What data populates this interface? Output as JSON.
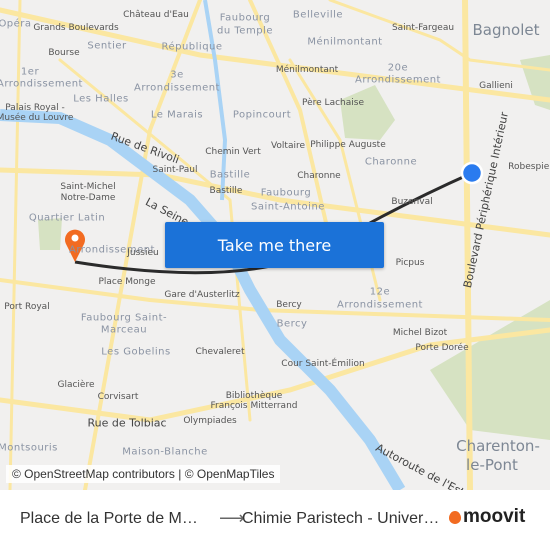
{
  "map": {
    "labels": [
      {
        "text": "Château d'Eau",
        "cls": ""
      },
      {
        "text": "Faubourg",
        "cls": "area"
      },
      {
        "text": "du Temple",
        "cls": "area"
      },
      {
        "text": "Belleville",
        "cls": "area"
      },
      {
        "text": "Saint-Fargeau",
        "cls": ""
      },
      {
        "text": "Bagnolet",
        "cls": "big"
      },
      {
        "text": "Opéra",
        "cls": "area"
      },
      {
        "text": "Grands Boulevards",
        "cls": ""
      },
      {
        "text": "Sentier",
        "cls": "area"
      },
      {
        "text": "République",
        "cls": "area"
      },
      {
        "text": "Ménilmontant",
        "cls": "area"
      },
      {
        "text": "Bourse",
        "cls": ""
      },
      {
        "text": "1er",
        "cls": "area"
      },
      {
        "text": "Arrondissement",
        "cls": "area"
      },
      {
        "text": "3e",
        "cls": "area"
      },
      {
        "text": "Arrondissement",
        "cls": "area"
      },
      {
        "text": "Ménilmontant",
        "cls": ""
      },
      {
        "text": "20e",
        "cls": "area"
      },
      {
        "text": "Arrondissement",
        "cls": "area"
      },
      {
        "text": "Gallieni",
        "cls": ""
      },
      {
        "text": "Palais Royal -",
        "cls": ""
      },
      {
        "text": "Musée du Louvre",
        "cls": ""
      },
      {
        "text": "Les Halles",
        "cls": "area"
      },
      {
        "text": "Père Lachaise",
        "cls": ""
      },
      {
        "text": "Le Marais",
        "cls": "area"
      },
      {
        "text": "Popincourt",
        "cls": "area"
      },
      {
        "text": "Rue de Rivoli",
        "cls": "street"
      },
      {
        "text": "Chemin Vert",
        "cls": ""
      },
      {
        "text": "Voltaire",
        "cls": ""
      },
      {
        "text": "Philippe Auguste",
        "cls": ""
      },
      {
        "text": "Charonne",
        "cls": "area"
      },
      {
        "text": "Boulevard Périphérique Intérieur",
        "cls": "street"
      },
      {
        "text": "Robespierre",
        "cls": ""
      },
      {
        "text": "Saint-Paul",
        "cls": ""
      },
      {
        "text": "Bastille",
        "cls": "area"
      },
      {
        "text": "Bastille",
        "cls": ""
      },
      {
        "text": "Charonne",
        "cls": ""
      },
      {
        "text": "Saint-Michel",
        "cls": ""
      },
      {
        "text": "Notre-Dame",
        "cls": ""
      },
      {
        "text": "La Seine",
        "cls": "street"
      },
      {
        "text": "Faubourg",
        "cls": "area"
      },
      {
        "text": "Saint-Antoine",
        "cls": "area"
      },
      {
        "text": "Buzenval",
        "cls": ""
      },
      {
        "text": "Quartier Latin",
        "cls": "area"
      },
      {
        "text": "Arrondissement",
        "cls": "area"
      },
      {
        "text": "Jussieu",
        "cls": ""
      },
      {
        "text": "Picpus",
        "cls": ""
      },
      {
        "text": "Place Monge",
        "cls": ""
      },
      {
        "text": "Gare d'Austerlitz",
        "cls": ""
      },
      {
        "text": "Bercy",
        "cls": ""
      },
      {
        "text": "12e",
        "cls": "area"
      },
      {
        "text": "Arrondissement",
        "cls": "area"
      },
      {
        "text": "Port Royal",
        "cls": ""
      },
      {
        "text": "Faubourg Saint-",
        "cls": "area"
      },
      {
        "text": "Marceau",
        "cls": "area"
      },
      {
        "text": "Bercy",
        "cls": "area"
      },
      {
        "text": "Michel Bizot",
        "cls": ""
      },
      {
        "text": "Porte Dorée",
        "cls": ""
      },
      {
        "text": "Les Gobelins",
        "cls": "area"
      },
      {
        "text": "Chevaleret",
        "cls": ""
      },
      {
        "text": "Cour Saint-Émilion",
        "cls": ""
      },
      {
        "text": "Glacière",
        "cls": ""
      },
      {
        "text": "Corvisart",
        "cls": ""
      },
      {
        "text": "Bibliothèque",
        "cls": ""
      },
      {
        "text": "François Mitterrand",
        "cls": ""
      },
      {
        "text": "Rue de Tolbiac",
        "cls": "street"
      },
      {
        "text": "Olympiades",
        "cls": ""
      },
      {
        "text": "Charenton-",
        "cls": "big"
      },
      {
        "text": "le-Pont",
        "cls": "big"
      },
      {
        "text": "Maison-Blanche",
        "cls": "area"
      },
      {
        "text": "Montsouris",
        "cls": "area"
      },
      {
        "text": "Autoroute de l'Est",
        "cls": "street"
      }
    ],
    "cta_label": "Take me there",
    "attribution": "© OpenStreetMap contributors | © OpenMapTiles",
    "colors": {
      "route": "#2b2b2b",
      "origin": "#2a7bef",
      "destination": "#f26b21",
      "button": "#1b72d8",
      "water": "#a9d3f5",
      "road": "#fbe7a1",
      "park": "#d6e2c2"
    }
  },
  "footer": {
    "from": "Place de la Porte de M…",
    "arrow": "⟶",
    "to": "Chimie Paristech - Univer…",
    "brand": "moovit"
  }
}
